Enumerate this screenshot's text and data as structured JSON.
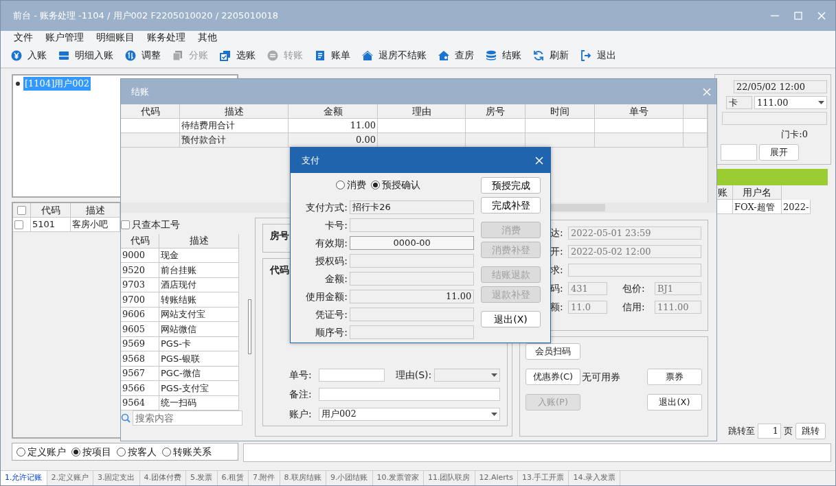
{
  "window": {
    "title": "前台 - 账务处理 -1104 / 用户002  F2205010020 / 2205010018"
  },
  "menu": [
    "文件",
    "账户管理",
    "明细账目",
    "账务处理",
    "其他"
  ],
  "toolbar": [
    {
      "label": "入账",
      "kind": "yen",
      "disabled": false
    },
    {
      "label": "明细入账",
      "kind": "tray",
      "disabled": false
    },
    {
      "label": "调整",
      "kind": "updown",
      "disabled": false
    },
    {
      "label": "分账",
      "kind": "docs",
      "disabled": true
    },
    {
      "label": "选账",
      "kind": "select",
      "disabled": false
    },
    {
      "label": "转账",
      "kind": "leftright",
      "disabled": true
    },
    {
      "label": "账单",
      "kind": "doc",
      "disabled": false
    },
    {
      "label": "退房不结账",
      "kind": "house",
      "disabled": false
    },
    {
      "label": "查房",
      "kind": "housesearch",
      "disabled": false
    },
    {
      "label": "结账",
      "kind": "database",
      "disabled": false
    },
    {
      "label": "刷新",
      "kind": "refresh",
      "disabled": false
    },
    {
      "label": "退出",
      "kind": "exit",
      "disabled": false
    }
  ],
  "account_tree": {
    "items": [
      {
        "label": "[1104]用户002",
        "selected": true
      }
    ]
  },
  "item_grid": {
    "select_all": false,
    "columns": [
      "代码",
      "描述"
    ],
    "rows": [
      {
        "checked": false,
        "cells": [
          "5101",
          "客房小吧"
        ]
      }
    ]
  },
  "view_modes": [
    {
      "label": "定义账户",
      "selected": false
    },
    {
      "label": "按项目",
      "selected": true
    },
    {
      "label": "按客人",
      "selected": false
    },
    {
      "label": "转账关系",
      "selected": false
    }
  ],
  "room_panel": {
    "departure": "22/05/02 12:00",
    "card_label": "卡",
    "credit": "111.00",
    "door_card": "门卡:0",
    "expand_button": "展开"
  },
  "log_grid": {
    "columns": [
      "账",
      "用户名"
    ],
    "rows": [
      [
        "",
        "FOX-超管",
        "2022-"
      ]
    ]
  },
  "pager": {
    "jump_label": "跳转至",
    "page": "1",
    "unit": "页",
    "jump_button": "跳转"
  },
  "checkout": {
    "title": "结账",
    "columns": [
      "代码",
      "描述",
      "金额",
      "理由",
      "房号",
      "时间",
      "单号"
    ],
    "rows": [
      [
        "",
        "待结费用合计",
        "11.00",
        "",
        "",
        "",
        ""
      ],
      [
        "",
        "预付款合计",
        "0.00",
        "",
        "",
        "",
        ""
      ]
    ],
    "own_only": {
      "label": "只查本工号",
      "checked": false
    },
    "payment_methods": {
      "columns": [
        "代码",
        "描述"
      ],
      "rows": [
        [
          "9000",
          "现金"
        ],
        [
          "9520",
          "前台挂账"
        ],
        [
          "9703",
          "酒店现付"
        ],
        [
          "9700",
          "转账结账"
        ],
        [
          "9606",
          "网站支付宝"
        ],
        [
          "9605",
          "网站微信"
        ],
        [
          "9569",
          "PGS-卡"
        ],
        [
          "9568",
          "PGS-银联"
        ],
        [
          "9567",
          "PGC-微信"
        ],
        [
          "9566",
          "PGS-支付宝"
        ],
        [
          "9564",
          "统一扫码"
        ]
      ],
      "search_placeholder": "搜索内容"
    },
    "room_label": "房号",
    "code_label": "代码",
    "form": {
      "bill_no_label": "单号:",
      "reason_label": "理由(S):",
      "note_label": "备注:",
      "account_label": "账户:",
      "account_value": "用户002"
    },
    "stay": {
      "arrival_label": "达:",
      "arrival": "2022-05-01 23:59",
      "leave_label": "开:",
      "leave": "2022-05-02 12:00",
      "request_label": "求:",
      "code_label": "码:",
      "code": "431",
      "package_label": "包价:",
      "package": "BJ1",
      "balance_label": "额:",
      "balance": "11.0",
      "credit_label": "信用:",
      "credit": "111.00"
    },
    "actions": {
      "member_scan": "会员扫码",
      "coupon": "优惠券(C)",
      "coupon_note": "无可用券",
      "voucher": "票券",
      "post": {
        "label": "入账(P)",
        "disabled": true
      },
      "exit": "退出(X)"
    }
  },
  "payment_dialog": {
    "title": "支付",
    "modes": [
      {
        "label": "消费",
        "selected": false
      },
      {
        "label": "预授确认",
        "selected": true
      }
    ],
    "fields": [
      {
        "label": "支付方式:",
        "value": "招行卡26",
        "kind": "text"
      },
      {
        "label": "卡号:",
        "kind": "text"
      },
      {
        "label": "有效期:",
        "value": "0000-00",
        "kind": "date"
      },
      {
        "label": "授权码:",
        "kind": "text"
      },
      {
        "label": "金额:",
        "kind": "amount"
      },
      {
        "label": "使用金额:",
        "value": "11.00",
        "kind": "amount"
      },
      {
        "label": "凭证号:",
        "kind": "text"
      },
      {
        "label": "顺序号:",
        "kind": "text"
      }
    ],
    "button_groups": [
      [
        {
          "label": "预授完成",
          "disabled": false
        },
        {
          "label": "完成补登",
          "disabled": false
        }
      ],
      [
        {
          "label": "消费",
          "disabled": true
        },
        {
          "label": "消费补登",
          "disabled": true
        }
      ],
      [
        {
          "label": "结账退款",
          "disabled": true
        },
        {
          "label": "退款补登",
          "disabled": true
        }
      ],
      [
        {
          "label": "退出(X)",
          "disabled": false
        }
      ]
    ]
  },
  "bottom_tabs": [
    {
      "label": "1.允许记账",
      "selected": true
    },
    {
      "label": "2.定义账户",
      "selected": false
    },
    {
      "label": "3.固定支出",
      "selected": false
    },
    {
      "label": "4.团体付费",
      "selected": false
    },
    {
      "label": "5.发票",
      "selected": false
    },
    {
      "label": "6.租赁",
      "selected": false
    },
    {
      "label": "7.附件",
      "selected": false
    },
    {
      "label": "8.联房结账",
      "selected": false
    },
    {
      "label": "9.小团结账",
      "selected": false
    },
    {
      "label": "10.发票管家",
      "selected": false
    },
    {
      "label": "11.团队联房",
      "selected": false
    },
    {
      "label": "12.Alerts",
      "selected": false
    },
    {
      "label": "13.手工开票",
      "selected": false
    },
    {
      "label": "14.录入发票",
      "selected": false
    }
  ]
}
